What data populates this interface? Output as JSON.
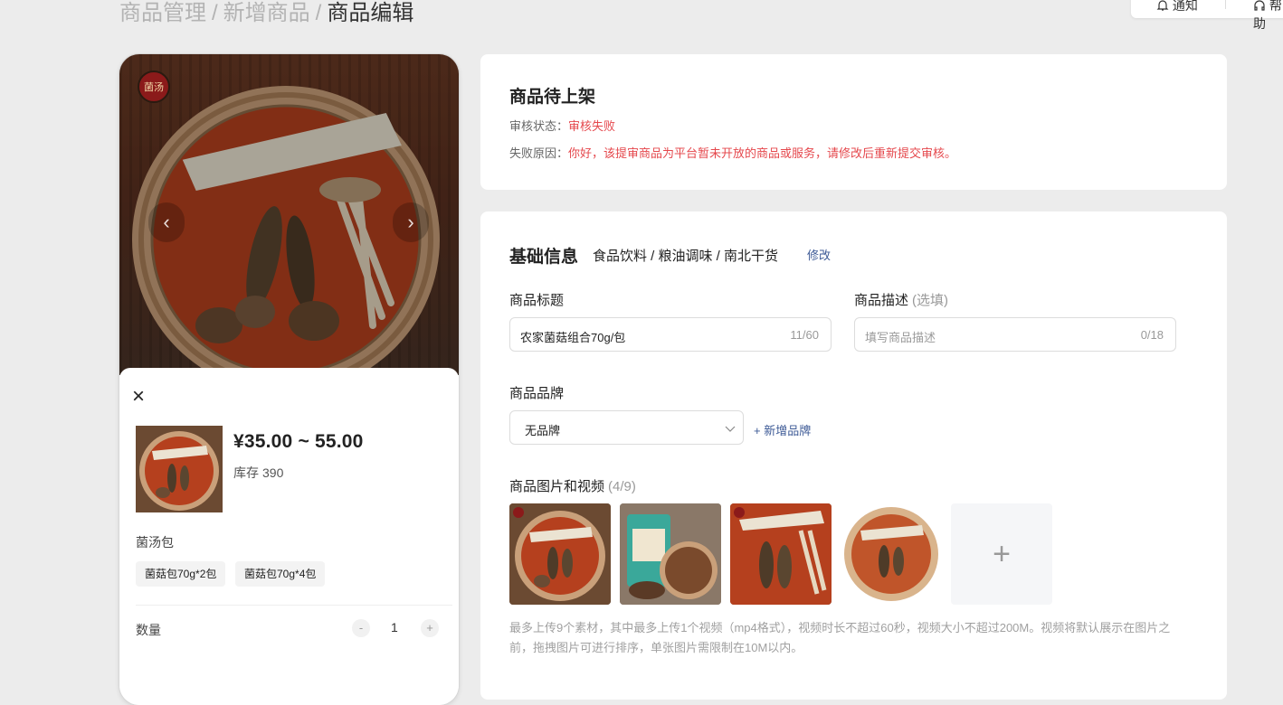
{
  "breadcrumb": {
    "items": [
      "商品管理",
      "新增商品"
    ],
    "separator": "/",
    "current": "商品编辑"
  },
  "top_actions": {
    "left": "通知",
    "right": "帮助"
  },
  "preview": {
    "logo_text": "菌汤",
    "price": "¥35.00 ~ 55.00",
    "stock_label": "库存",
    "stock_value": "390",
    "spec_group": "菌汤包",
    "spec_options": [
      "菌菇包70g*2包",
      "菌菇包70g*4包"
    ],
    "quantity_label": "数量",
    "quantity_value": "1",
    "minus": "-",
    "plus": "+"
  },
  "status_card": {
    "title": "商品待上架",
    "review_label": "审核状态：",
    "review_value": "审核失败",
    "reason_label": "失败原因：",
    "reason_value": "你好，该提审商品为平台暂未开放的商品或服务，请修改后重新提交审核。"
  },
  "basic_info": {
    "title": "基础信息",
    "category": "食品饮料 / 粮油调味 / 南北干货",
    "modify": "修改",
    "title_label": "商品标题",
    "title_value": "农家菌菇组合70g/包",
    "title_count": "11/60",
    "desc_label": "商品描述",
    "desc_optional": "(选填)",
    "desc_placeholder": "填写商品描述",
    "desc_count": "0/18",
    "brand_label": "商品品牌",
    "brand_value": "无品牌",
    "add_brand": "+ 新增品牌",
    "media_label": "商品图片和视频",
    "media_count": "(4/9)",
    "media_hint": "最多上传9个素材，其中最多上传1个视频（mp4格式），视频时长不超过60秒，视频大小不超过200M。视频将默认展示在图片之前，拖拽图片可进行排序，单张图片需限制在10M以内。"
  },
  "colors": {
    "accent_link": "#3d5a96",
    "error": "#e5484d",
    "page_bg": "#ececec"
  }
}
